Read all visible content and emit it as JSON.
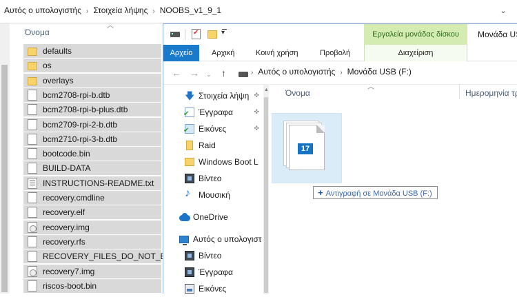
{
  "background_window": {
    "breadcrumbs": [
      "Αυτός ο υπολογιστής",
      "Στοιχεία λήψης",
      "NOOBS_v1_9_1"
    ],
    "column_name": "Όνομα",
    "files": [
      {
        "name": "defaults",
        "icon": "folder-icon"
      },
      {
        "name": "os",
        "icon": "folder-icon"
      },
      {
        "name": "overlays",
        "icon": "folder-icon"
      },
      {
        "name": "bcm2708-rpi-b.dtb",
        "icon": "file-icon"
      },
      {
        "name": "bcm2708-rpi-b-plus.dtb",
        "icon": "file-icon"
      },
      {
        "name": "bcm2709-rpi-2-b.dtb",
        "icon": "file-icon"
      },
      {
        "name": "bcm2710-rpi-3-b.dtb",
        "icon": "file-icon"
      },
      {
        "name": "bootcode.bin",
        "icon": "file-icon"
      },
      {
        "name": "BUILD-DATA",
        "icon": "file-icon"
      },
      {
        "name": "INSTRUCTIONS-README.txt",
        "icon": "text-file-icon"
      },
      {
        "name": "recovery.cmdline",
        "icon": "file-icon"
      },
      {
        "name": "recovery.elf",
        "icon": "file-icon"
      },
      {
        "name": "recovery.img",
        "icon": "disc-image-icon"
      },
      {
        "name": "recovery.rfs",
        "icon": "file-icon"
      },
      {
        "name": "RECOVERY_FILES_DO_NOT_EDIT",
        "icon": "file-icon"
      },
      {
        "name": "recovery7.img",
        "icon": "disc-image-icon"
      },
      {
        "name": "riscos-boot.bin",
        "icon": "file-icon"
      }
    ]
  },
  "foreground_window": {
    "context_tab_header": "Εργαλεία μονάδας δίσκου",
    "window_title": "Μονάδα USB (F:)",
    "ribbon_tabs": {
      "file": "Αρχείο",
      "home": "Αρχική",
      "share": "Κοινή χρήση",
      "view": "Προβολή",
      "manage": "Διαχείριση"
    },
    "breadcrumbs": [
      "Αυτός ο υπολογιστής",
      "Μονάδα USB (F:)"
    ],
    "nav_pane": [
      {
        "label": "Στοιχεία λήψη",
        "icon": "download-icon",
        "pinned": true
      },
      {
        "label": "Έγγραφα",
        "icon": "documents-icon",
        "pinned": true
      },
      {
        "label": "Εικόνες",
        "icon": "pictures-icon",
        "pinned": true
      },
      {
        "label": "Raid",
        "icon": "folder-icon",
        "pinned": false
      },
      {
        "label": "Windows Boot L",
        "icon": "folder-icon",
        "pinned": false
      },
      {
        "label": "Βίντεο",
        "icon": "videos-icon",
        "pinned": false
      },
      {
        "label": "Μουσική",
        "icon": "music-icon",
        "pinned": false
      },
      {
        "label": "OneDrive",
        "icon": "onedrive-icon",
        "pinned": false
      },
      {
        "label": "Αυτός ο υπολογιστ",
        "icon": "this-pc-icon",
        "pinned": false
      },
      {
        "label": "Βίντεο",
        "icon": "videos-icon",
        "pinned": false
      },
      {
        "label": "Έγγραφα",
        "icon": "documents-icon",
        "pinned": false
      },
      {
        "label": "Εικόνες",
        "icon": "pictures-icon",
        "pinned": false
      }
    ],
    "column_name": "Όνομα",
    "column_date": "Ημερομηνία τρ"
  },
  "drag": {
    "count": "17",
    "tooltip": "Αντιγραφή σε Μονάδα USB (F:)"
  },
  "colors": {
    "accent": "#1979ca",
    "selection": "#d9d9d9",
    "context_tab": "#d4ebb1",
    "drag_ghost": "#cce4f7"
  }
}
